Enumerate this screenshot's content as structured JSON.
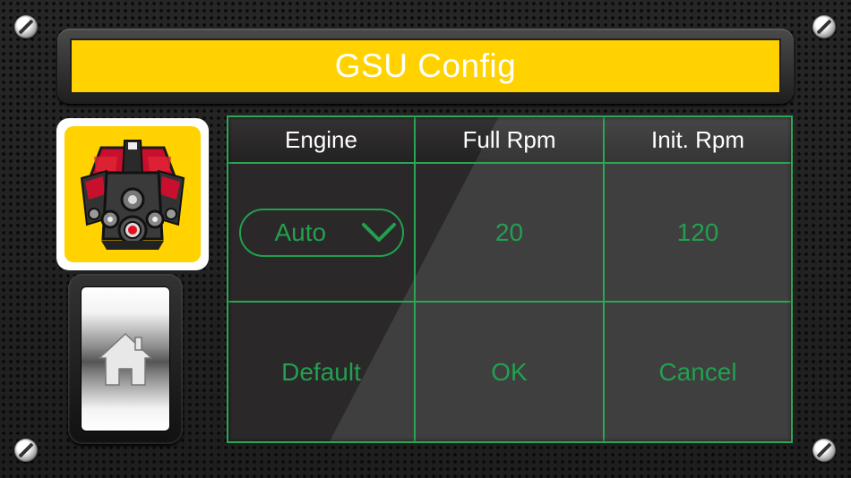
{
  "title": "GSU Config",
  "icons": {
    "engine": "engine-block-icon",
    "home": "home-icon",
    "dropdown": "chevron-down-icon",
    "screw": "screw-icon"
  },
  "colors": {
    "title_bar": "#ffd200",
    "grid_lines": "#2aa655",
    "value_text": "#22a050",
    "header_text": "#ffffff"
  },
  "table": {
    "headers": [
      "Engine",
      "Full Rpm",
      "Init. Rpm"
    ],
    "engine_select": {
      "value": "Auto"
    },
    "full_rpm": "20",
    "init_rpm": "120",
    "actions": {
      "default_label": "Default",
      "ok_label": "OK",
      "cancel_label": "Cancel"
    }
  }
}
